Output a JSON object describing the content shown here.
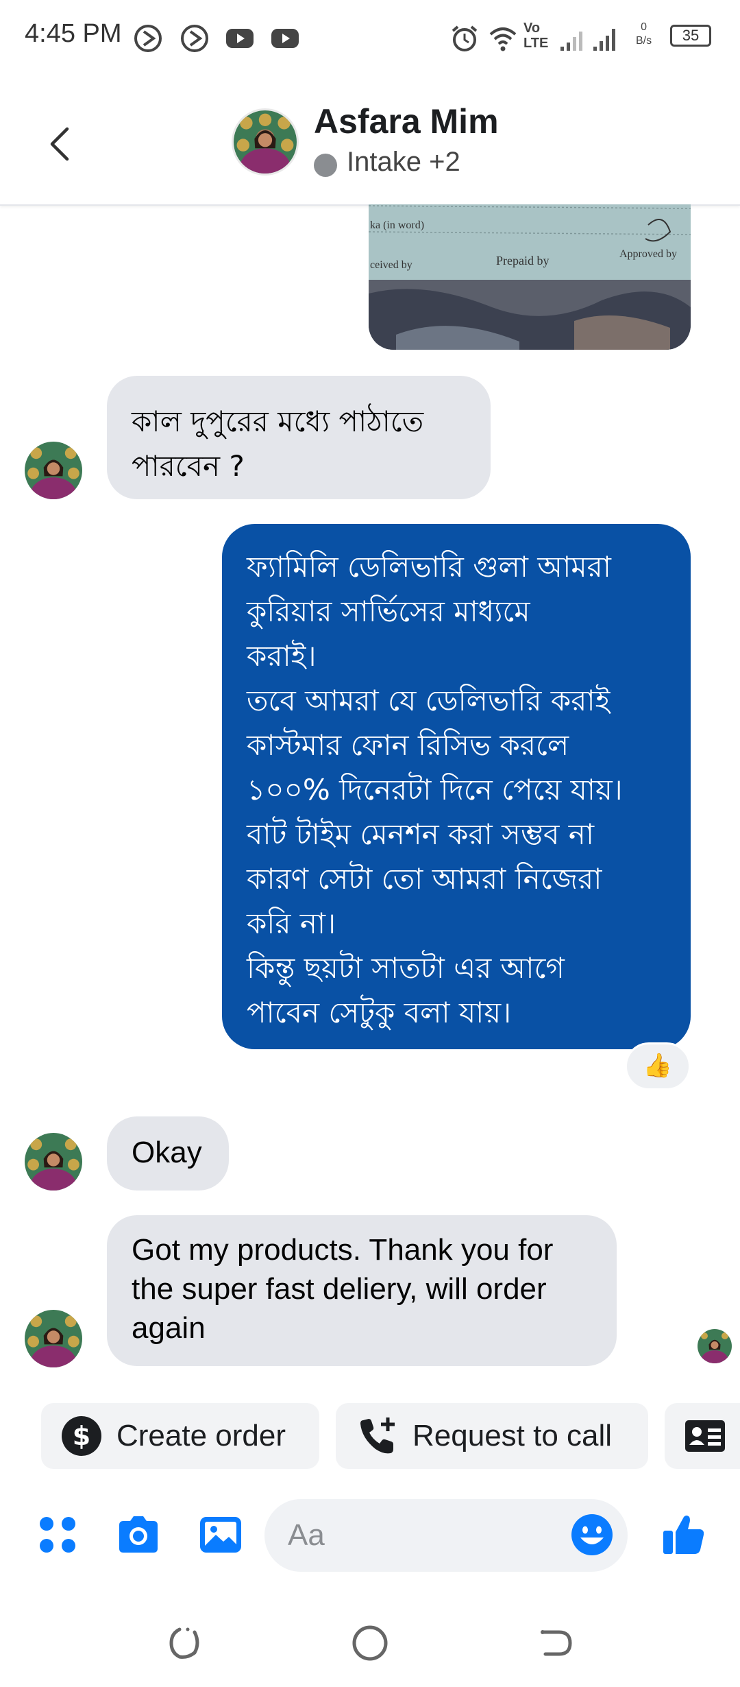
{
  "status_bar": {
    "time": "4:45 PM",
    "net_speed": "0\nB/s",
    "volte": "Vo\nLTE",
    "battery": "35",
    "icons": [
      "media-notification-icon",
      "media-notification-icon",
      "youtube-icon",
      "youtube-icon",
      "alarm-icon",
      "wifi-icon",
      "signal-icon",
      "signal-icon",
      "battery-icon"
    ]
  },
  "header": {
    "contact_name": "Asfara Mim",
    "subtitle": "Intake +2",
    "icons": [
      "back-arrow-icon",
      "contact-avatar",
      "presence-dot"
    ]
  },
  "attachment": {
    "lines": [
      "ka (in word)",
      "ceived by",
      "Prepaid by",
      "Approved by"
    ]
  },
  "messages": [
    {
      "direction": "incoming",
      "text": "কাল দুপুরের মধ্যে পাঠাতে\nপারবেন ?"
    },
    {
      "direction": "outgoing",
      "text": "ফ্যামিলি ডেলিভারি গুলা আমরা\nকুরিয়ার সার্ভিসের মাধ্যমে\nকরাই।\nতবে আমরা যে ডেলিভারি করাই\nকাস্টমার ফোন রিসিভ করলে\n১০০% দিনেরটা দিনে পেয়ে যায়।\nবাট টাইম মেনশন করা সম্ভব না\nকারণ সেটা তো আমরা নিজেরা\nকরি না।\nকিন্তু ছয়টা সাতটা এর আগে\nপাবেন সেটুকু বলা যায়।",
      "reaction": "👍"
    },
    {
      "direction": "incoming",
      "text": "Okay"
    },
    {
      "direction": "incoming",
      "text": "Got my products. Thank you for\nthe super fast deliery, will order\nagain"
    }
  ],
  "quick_actions": [
    {
      "label": "Create order",
      "icon": "dollar-icon"
    },
    {
      "label": "Request to call",
      "icon": "phone-add-icon"
    },
    {
      "label": "",
      "icon": "contact-card-icon"
    }
  ],
  "composer": {
    "placeholder": "Aa",
    "icons": [
      "apps-menu-icon",
      "camera-icon",
      "gallery-icon",
      "emoji-icon",
      "like-icon"
    ]
  },
  "nav_bar": {
    "icons": [
      "recents-icon",
      "home-icon",
      "back-nav-icon"
    ]
  },
  "colors": {
    "outgoing_bubble": "#0951a5",
    "incoming_bubble": "#e4e6eb",
    "accent": "#0a7cff"
  }
}
